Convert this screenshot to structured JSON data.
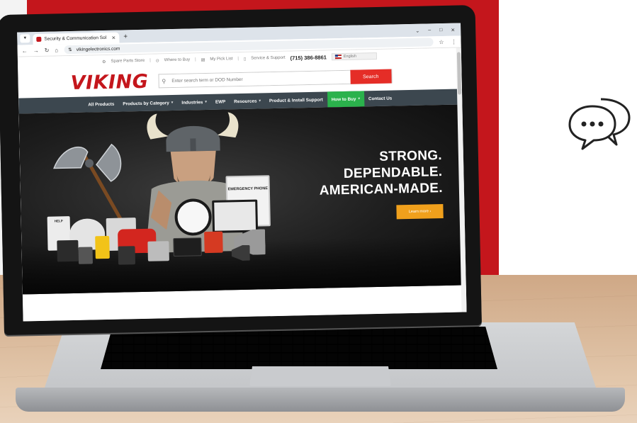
{
  "browser": {
    "tab_menu": "▾",
    "tab_title": "Security & Communication Sol",
    "tab_close": "✕",
    "new_tab": "+",
    "window_controls": [
      "⌄",
      "–",
      "□",
      "✕"
    ],
    "url": "vikingelectronics.com",
    "nav_back": "←",
    "nav_forward": "→",
    "reload": "↻",
    "home": "⌂",
    "site_info": "⇅",
    "bookmark_star": "☆",
    "menu_dots": "⋮"
  },
  "utility_bar": {
    "spare_parts": "Spare Parts Store",
    "where_to_buy": "Where to Buy",
    "my_pick_list": "My Pick List",
    "service_support": "Service & Support",
    "phone": "(715) 386-8861",
    "language": "English",
    "separator": "|"
  },
  "brand": {
    "logo_text": "VIKING",
    "search_placeholder": "Enter search term or DOD Number",
    "search_button": "Search"
  },
  "nav": {
    "items": [
      {
        "label": "All Products",
        "has_dropdown": false
      },
      {
        "label": "Products by Category",
        "has_dropdown": true
      },
      {
        "label": "Industries",
        "has_dropdown": true
      },
      {
        "label": "EWP",
        "has_dropdown": false
      },
      {
        "label": "Resources",
        "has_dropdown": true
      },
      {
        "label": "Product & Install Support",
        "has_dropdown": false
      },
      {
        "label": "How to Buy",
        "has_dropdown": true,
        "highlighted": true
      },
      {
        "label": "Contact Us",
        "has_dropdown": false
      }
    ],
    "caret": "▾"
  },
  "hero": {
    "line1": "STRONG.",
    "line2": "DEPENDABLE.",
    "line3": "AMERICAN-MADE.",
    "cta": "Learn more ›",
    "sign_text": "EMERGENCY PHONE",
    "help_text": "HELP"
  },
  "colors": {
    "brand_red": "#c4161c",
    "search_button": "#e52d27",
    "nav_bg": "#3c474f",
    "nav_highlight": "#2bb24c",
    "cta": "#f0a01c"
  },
  "icons": [
    "chat-bubbles-icon",
    "spare-parts-icon",
    "location-pin-icon",
    "pick-list-icon",
    "phone-book-icon",
    "magnifier-icon",
    "us-flag-icon"
  ]
}
